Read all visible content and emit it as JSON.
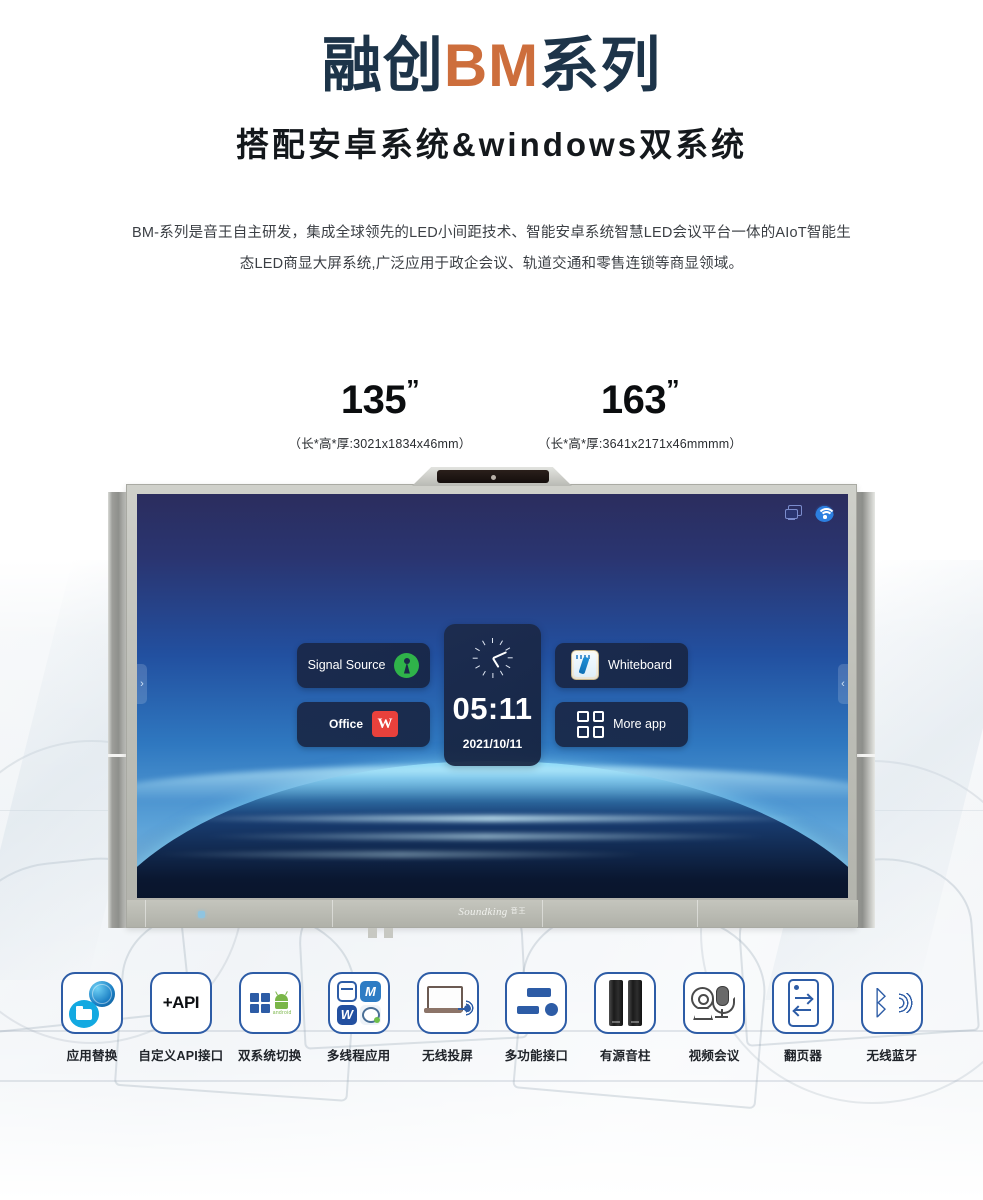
{
  "header": {
    "title_prefix": "融创",
    "title_accent": "BM",
    "title_suffix": "系列",
    "subtitle": "搭配安卓系统&windows双系统",
    "description": "BM-系列是音王自主研发，集成全球领先的LED小间距技术、智能安卓系统智慧LED会议平台一体的AIoT智能生态LED商显大屏系统,广泛应用于政企会议、轨道交通和零售连锁等商显领域。",
    "accent_color": "#cd6e3c",
    "title_color": "#1d3449"
  },
  "sizes": [
    {
      "inches": "135",
      "unit": "”",
      "dimensions": "（长*高*厚:3021x1834x46mm）"
    },
    {
      "inches": "163",
      "unit": "”",
      "dimensions": "（长*高*厚:3641x2171x46mmmm）"
    }
  ],
  "display": {
    "status": {
      "cast_icon": "screen-cast-icon",
      "wifi_icon": "wifi-icon"
    },
    "tiles": {
      "signal_source": "Signal Source",
      "office": "Office",
      "whiteboard": "Whiteboard",
      "more_app": "More app"
    },
    "clock": {
      "time": "05:11",
      "date": "2021/10/11"
    },
    "brand": "Soundking",
    "brand_cn": "音王"
  },
  "features": [
    {
      "label": "应用替换",
      "icon": "app-replace-icon"
    },
    {
      "label": "自定义API接口",
      "icon": "api-icon",
      "text": "+API"
    },
    {
      "label": "双系统切换",
      "icon": "dual-system-icon",
      "watermark": "android"
    },
    {
      "label": "多线程应用",
      "icon": "multithread-icon",
      "glyphs": [
        "",
        "M",
        "W",
        ""
      ]
    },
    {
      "label": "无线投屏",
      "icon": "wireless-cast-icon"
    },
    {
      "label": "多功能接口",
      "icon": "multifunction-port-icon"
    },
    {
      "label": "有源音柱",
      "icon": "active-speaker-icon"
    },
    {
      "label": "视频会议",
      "icon": "video-conference-icon"
    },
    {
      "label": "翻页器",
      "icon": "page-turner-icon"
    },
    {
      "label": "无线蓝牙",
      "icon": "bluetooth-icon",
      "glyph": "ᛒ"
    }
  ]
}
